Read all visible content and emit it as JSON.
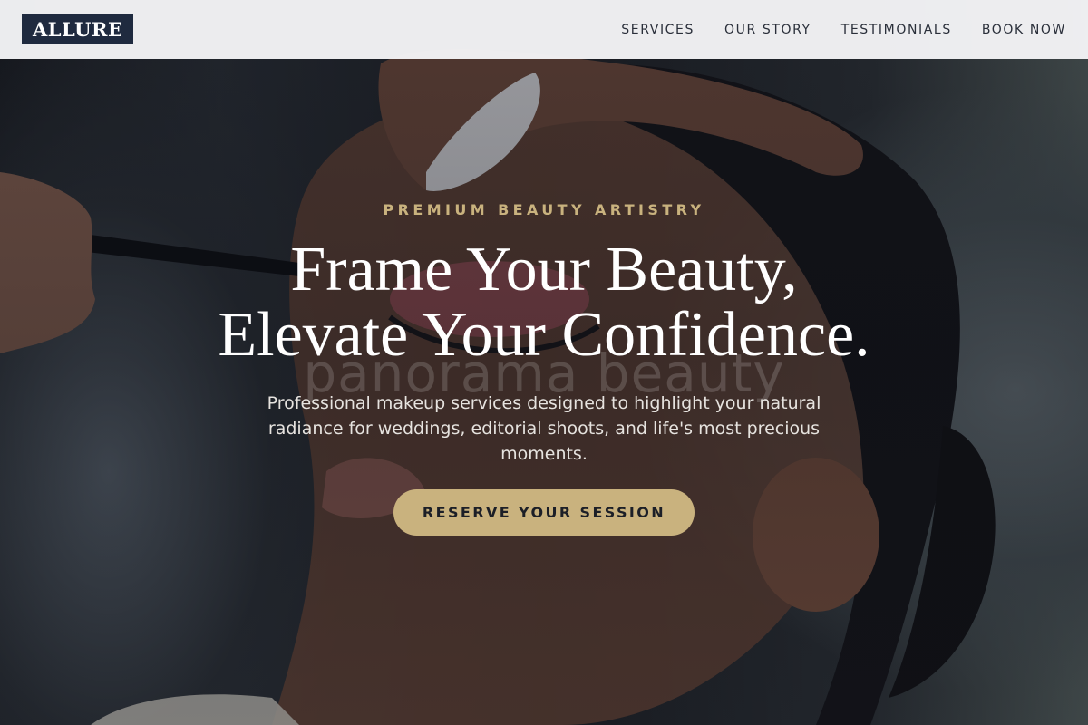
{
  "brand": {
    "logo_text": "ALLURE"
  },
  "nav": {
    "links": [
      {
        "label": "SERVICES"
      },
      {
        "label": "OUR STORY"
      },
      {
        "label": "TESTIMONIALS"
      },
      {
        "label": "BOOK NOW"
      }
    ]
  },
  "hero": {
    "eyebrow": "PREMIUM BEAUTY ARTISTRY",
    "headline_line1": "Frame Your Beauty,",
    "headline_line2": "Elevate Your Confidence.",
    "watermark": "panorama beauty",
    "subtext": "Professional makeup services designed to highlight your natural radiance for weddings, editorial shoots, and life's most precious moments.",
    "cta_label": "RESERVE YOUR SESSION",
    "background_image": "makeup-artist-applying-eyeliner-photo"
  },
  "colors": {
    "accent_gold": "#c9b27e",
    "logo_navy": "#1f2a3f",
    "nav_background": "#f5f5f7",
    "nav_text": "#2a2f3a",
    "headline_white": "#ffffff",
    "cta_text": "#1c1f27"
  }
}
